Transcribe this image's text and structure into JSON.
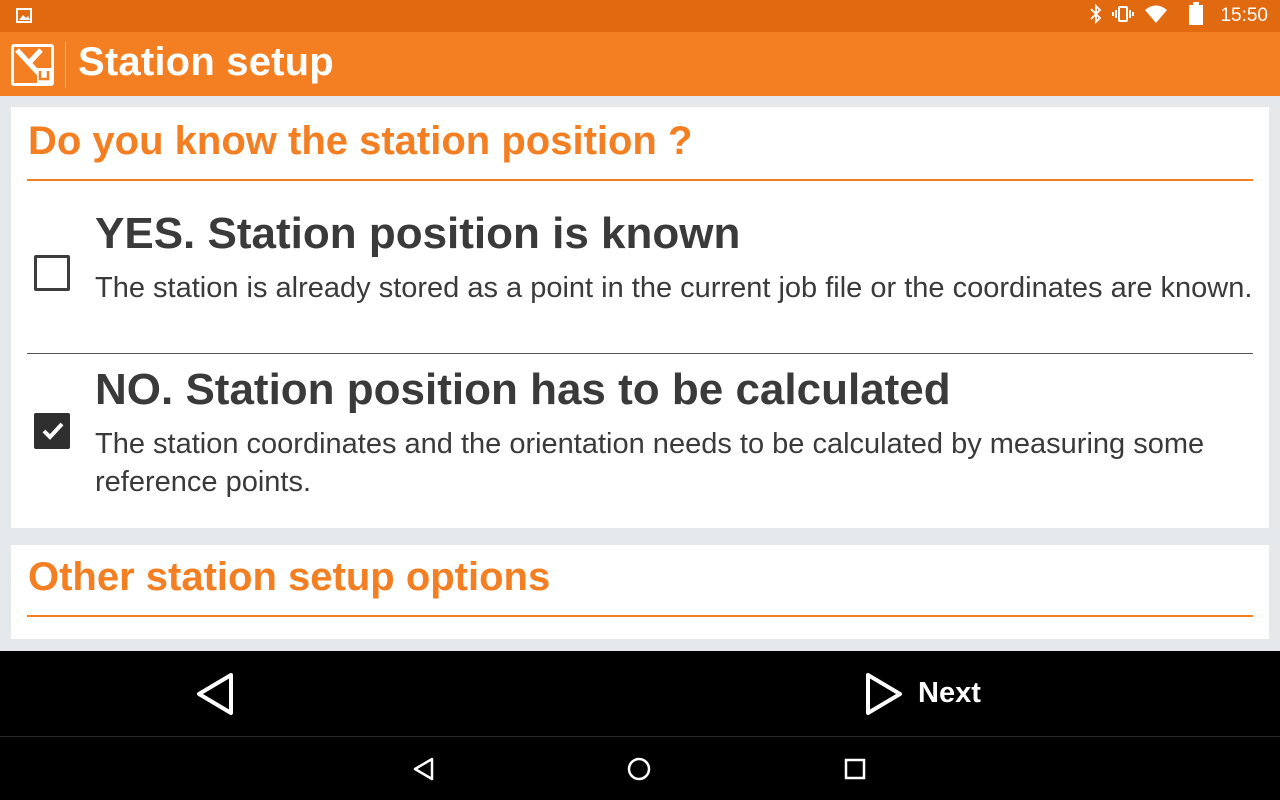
{
  "status_bar": {
    "time": "15:50",
    "icons": [
      "gallery-icon",
      "bluetooth-icon",
      "vibrate-icon",
      "wifi-icon",
      "battery-icon"
    ]
  },
  "app_bar": {
    "title": "Station setup",
    "logo_icon": "app-logo-icon"
  },
  "question_section": {
    "title": "Do you know the station position ?",
    "options": [
      {
        "title": "YES. Station position is known",
        "description": "The station is already stored as a point in the current job file or the coordinates are known.",
        "checked": false
      },
      {
        "title": "NO. Station position has to be calculated",
        "description": "The station coordinates and the orientation needs to be calculated by measuring some reference points.",
        "checked": true
      }
    ]
  },
  "other_section": {
    "title": "Other station setup options"
  },
  "action_bar": {
    "back_icon": "back-triangle-icon",
    "next_label": "Next",
    "next_icon": "next-triangle-icon"
  },
  "nav_bar": {
    "icons": [
      "nav-back-icon",
      "nav-home-icon",
      "nav-recents-icon"
    ]
  },
  "colors": {
    "status_bar": "#e1690f",
    "accent": "#f47f22",
    "text": "#3a3a3a",
    "background": "#e6e9ec"
  }
}
